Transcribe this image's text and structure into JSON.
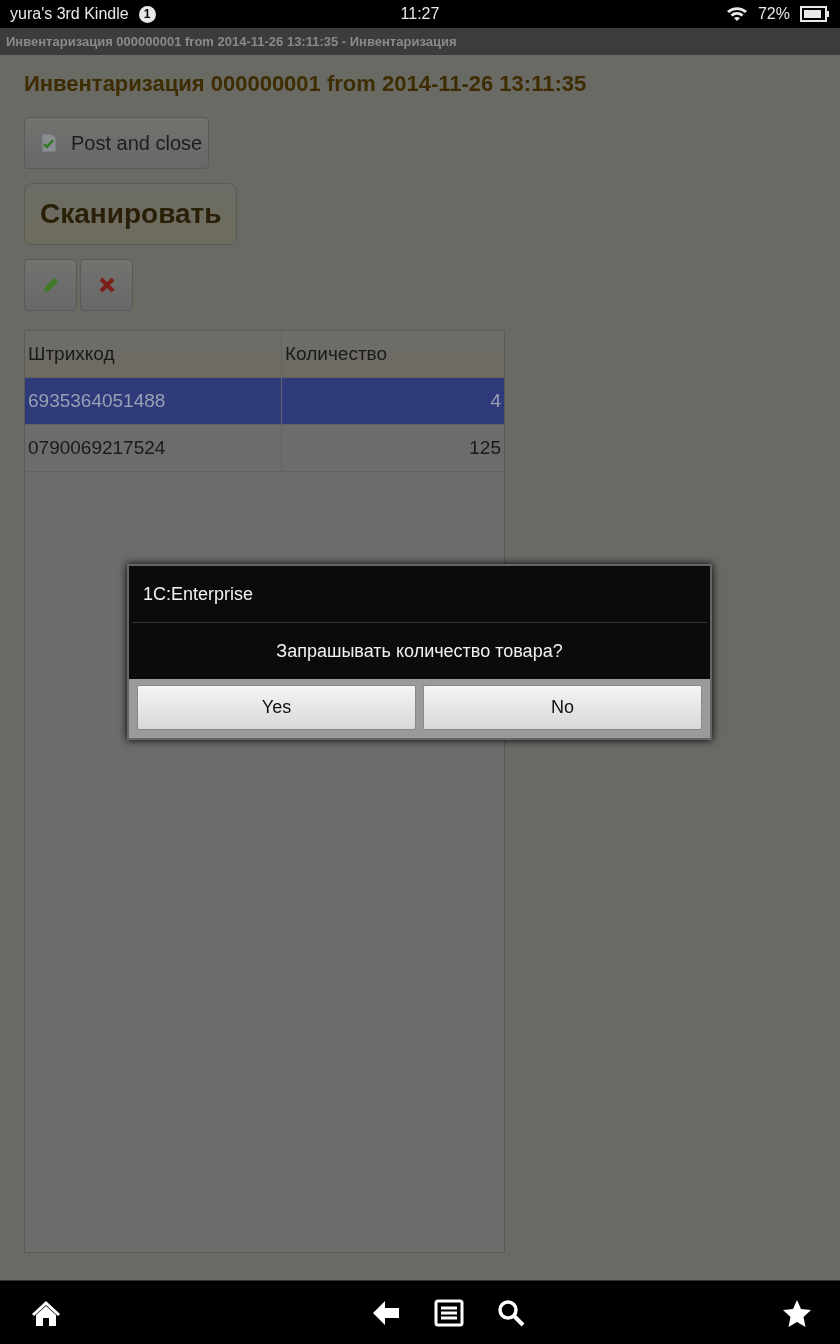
{
  "status_bar": {
    "device_name": "yura's 3rd Kindle",
    "notification_count": "1",
    "time": "11:27",
    "battery": "72%"
  },
  "window": {
    "title": "Инвентаризация 000000001 from 2014-11-26 13:11:35 - Инвентаризация"
  },
  "form": {
    "heading": "Инвентаризация 000000001 from 2014-11-26 13:11:35",
    "post_button": "Post and close",
    "scan_button": "Сканировать"
  },
  "table": {
    "columns": [
      "Штрихкод",
      "Количество"
    ],
    "rows": [
      {
        "cells": [
          "6935364051488",
          "4"
        ],
        "selected": true
      },
      {
        "cells": [
          "0790069217524",
          "125"
        ],
        "selected": false
      }
    ]
  },
  "dialog": {
    "title": "1C:Enterprise",
    "message": "Запрашывать количество товара?",
    "buttons": [
      "Yes",
      "No"
    ]
  }
}
